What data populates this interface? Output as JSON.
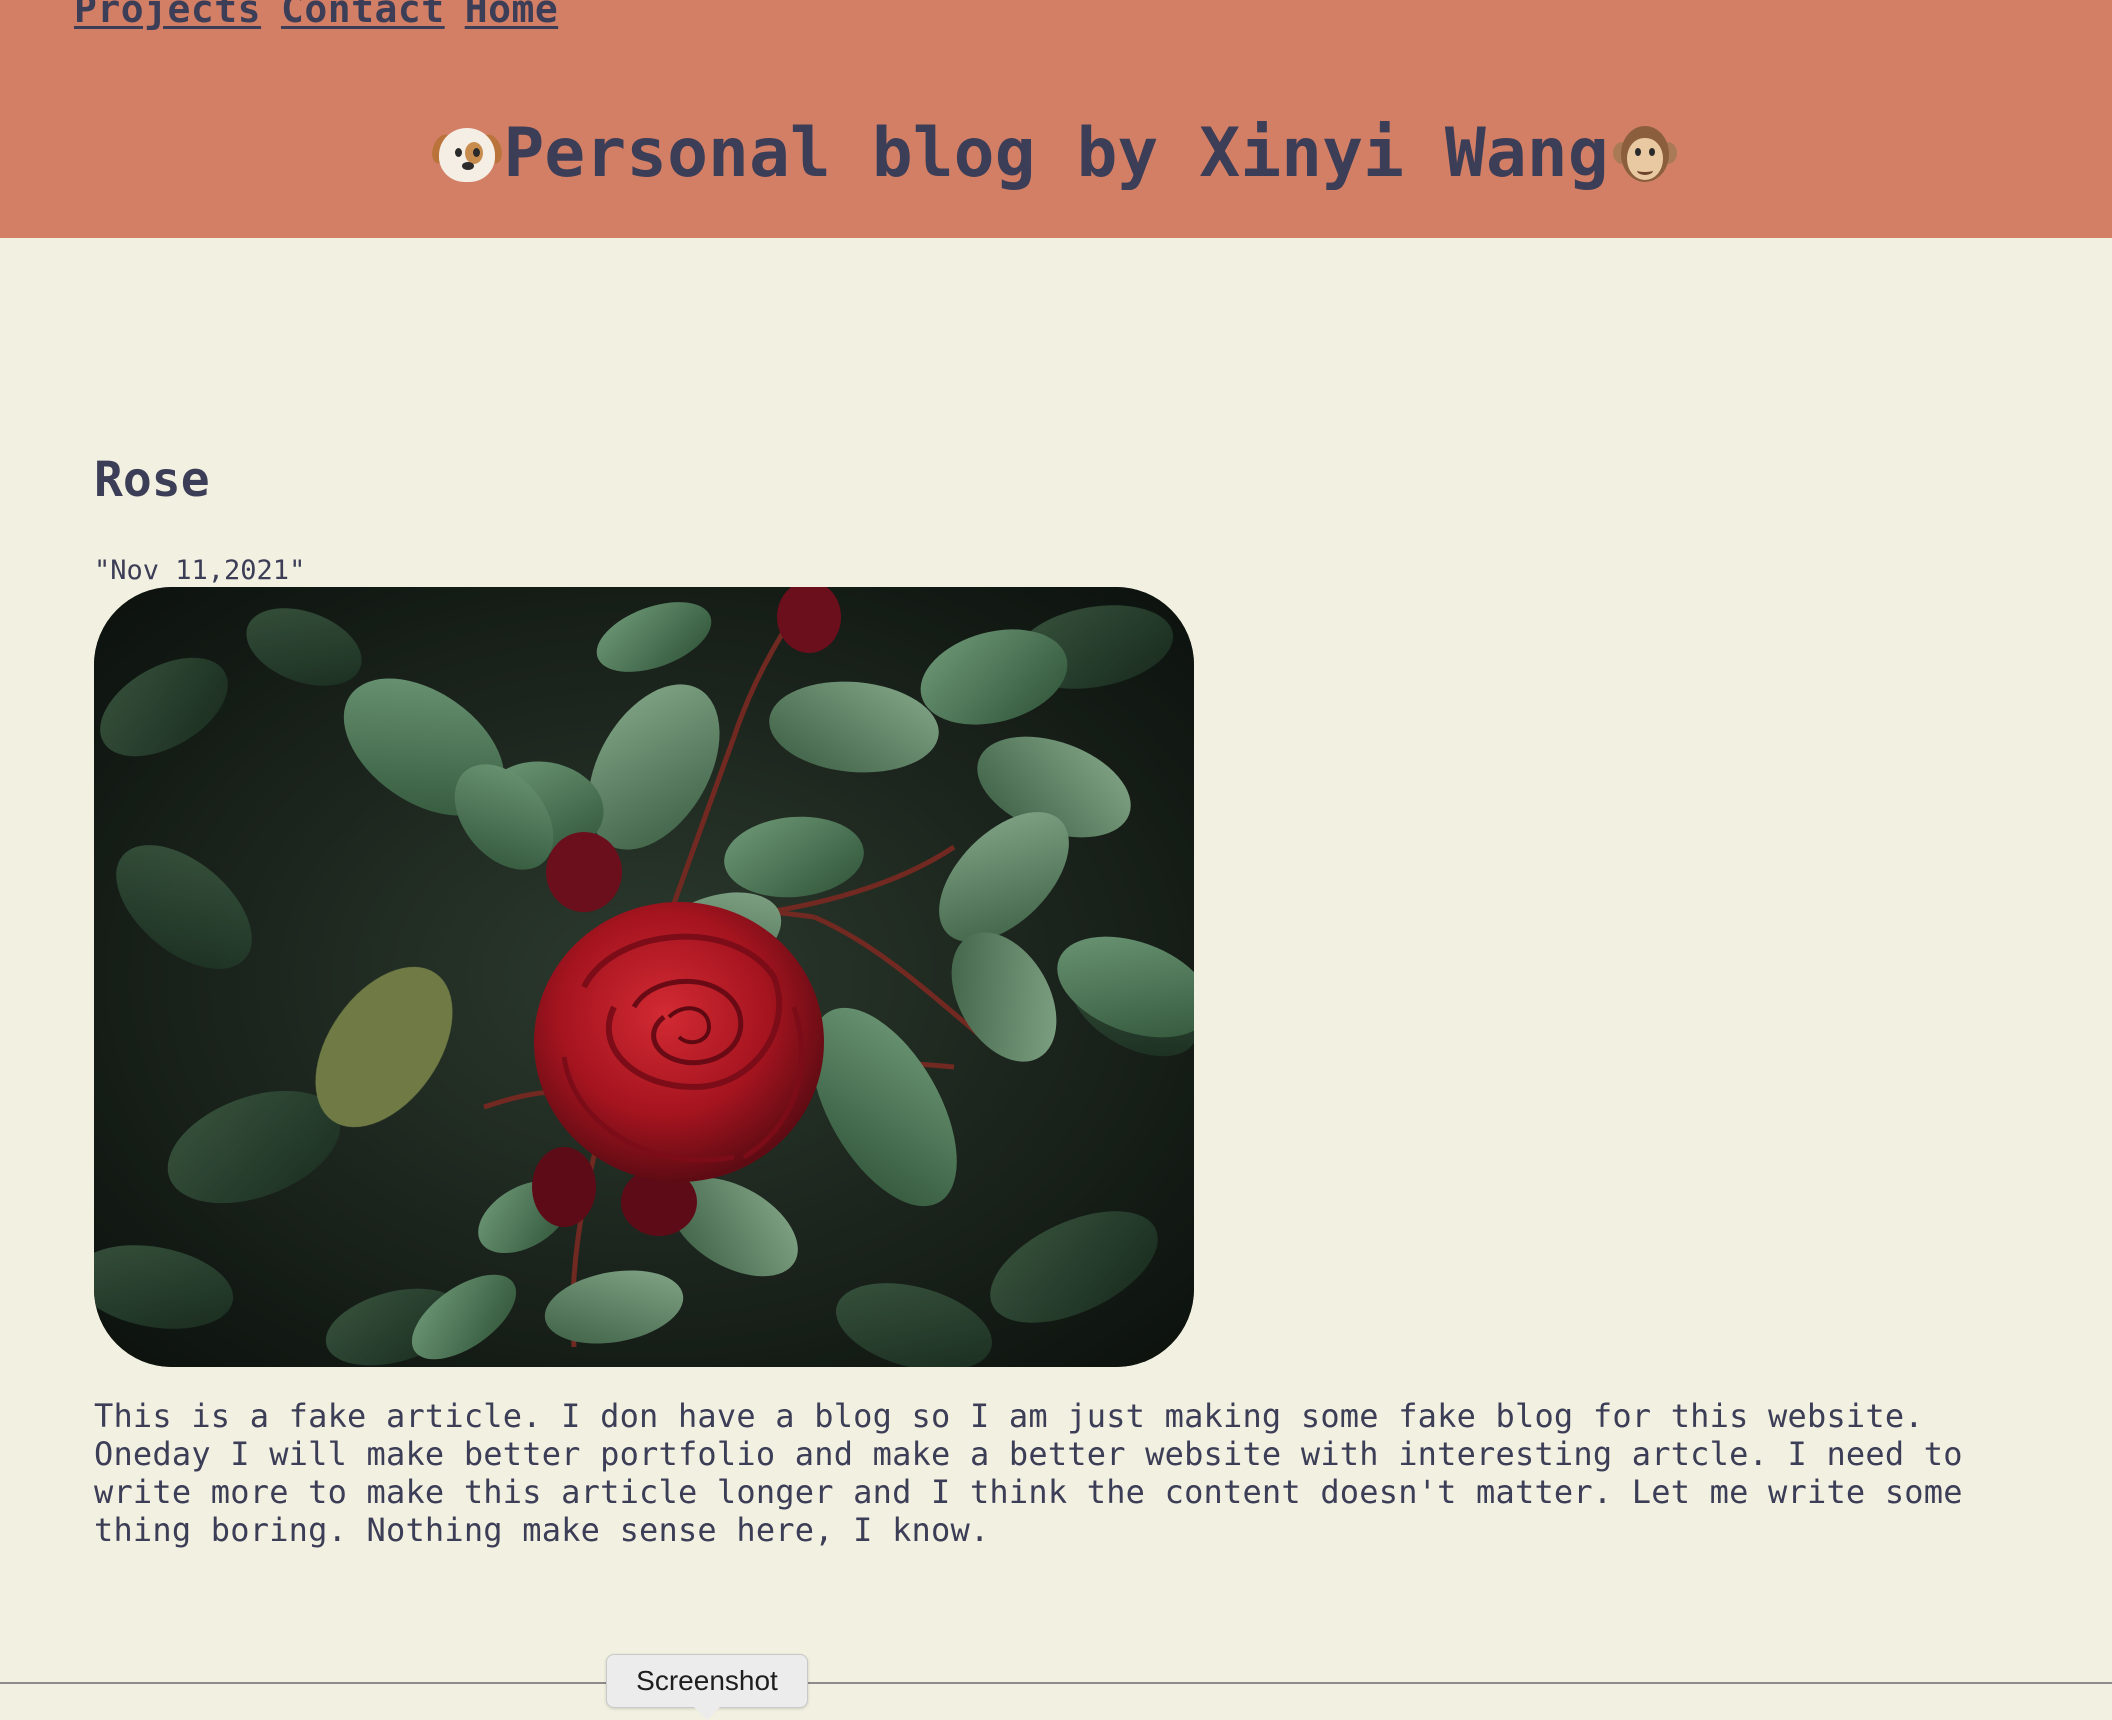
{
  "nav": {
    "items": [
      {
        "label": "Projects"
      },
      {
        "label": "Contact"
      },
      {
        "label": "Home"
      }
    ]
  },
  "header": {
    "title": "Personal blog by Xinyi Wang",
    "left_emoji": "dog-face-icon",
    "right_emoji": "monkey-face-icon"
  },
  "post": {
    "title": "Rose",
    "date": "\"Nov 11,2021\"",
    "image_alt": "red rose with leaves",
    "body": "This is a fake article. I don have a blog so I am just making some fake blog for this website.\nOneday I will make better portfolio and make a better website with interesting artcle. I need to\nwrite more to make this article longer and I think the content doesn't matter. Let me write some\nthing boring. Nothing make sense here, I know."
  },
  "tooltip": {
    "label": "Screenshot"
  },
  "colors": {
    "header_bg": "#d37f66",
    "page_bg": "#f2f1e1",
    "text": "#3c3d56"
  }
}
